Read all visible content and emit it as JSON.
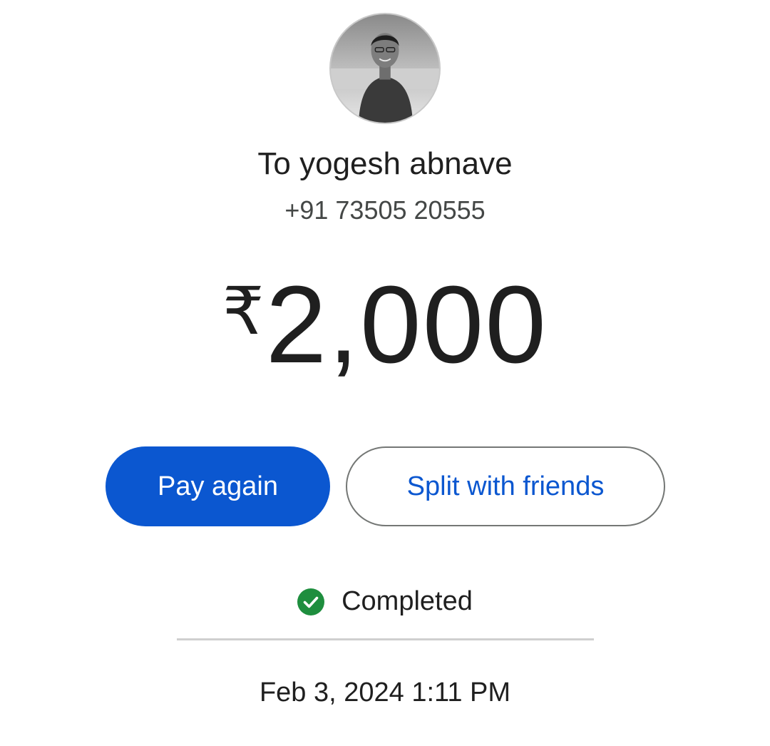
{
  "recipient": {
    "name_line": "To yogesh abnave",
    "phone": "+91 73505 20555"
  },
  "amount": {
    "currency_symbol": "₹",
    "value": "2,000"
  },
  "actions": {
    "pay_again_label": "Pay again",
    "split_label": "Split with friends"
  },
  "status": {
    "text": "Completed",
    "icon": "check-circle-icon",
    "color": "#1e8e3e"
  },
  "timestamp": "Feb 3, 2024 1:11 PM",
  "colors": {
    "primary": "#0b57d0",
    "text": "#1f1f1f",
    "secondary_text": "#444746"
  }
}
